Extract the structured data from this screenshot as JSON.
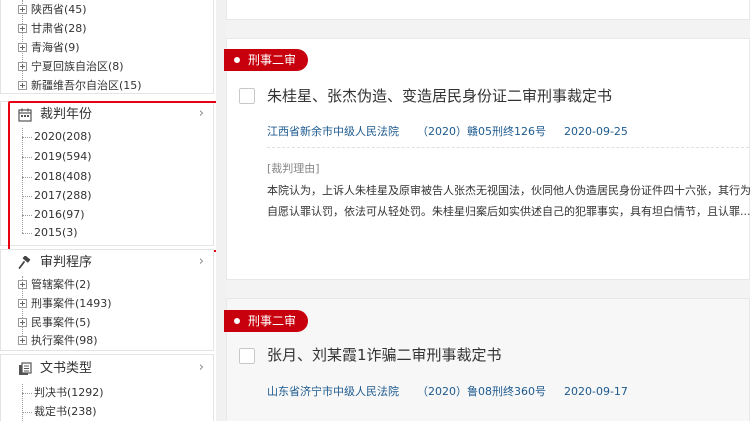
{
  "sidebar": {
    "region_items": [
      {
        "label": "陕西省(45)"
      },
      {
        "label": "甘肃省(28)"
      },
      {
        "label": "青海省(9)"
      },
      {
        "label": "宁夏回族自治区(8)"
      },
      {
        "label": "新疆维吾尔自治区(15)"
      }
    ],
    "year_section": {
      "title": "裁判年份",
      "chevron": "›",
      "items": [
        {
          "label": "2020(208)"
        },
        {
          "label": "2019(594)"
        },
        {
          "label": "2018(408)"
        },
        {
          "label": "2017(288)"
        },
        {
          "label": "2016(97)"
        },
        {
          "label": "2015(3)"
        }
      ]
    },
    "procedure_section": {
      "title": "审判程序",
      "chevron": "›",
      "items": [
        {
          "label": "管辖案件(2)"
        },
        {
          "label": "刑事案件(1493)"
        },
        {
          "label": "民事案件(5)"
        },
        {
          "label": "执行案件(98)"
        }
      ]
    },
    "doctype_section": {
      "title": "文书类型",
      "chevron": "›",
      "items": [
        {
          "label": "判决书(1292)"
        },
        {
          "label": "裁定书(238)"
        }
      ]
    }
  },
  "results": [
    {
      "tag": "刑事二审",
      "title": "朱桂星、张杰伪造、变造居民身份证二审刑事裁定书",
      "court": "江西省新余市中级人民法院",
      "case_no": "（2020）赣05刑终126号",
      "date": "2020-09-25",
      "reason_label": "[裁判理由]",
      "summary_line1": "本院认为，上诉人朱桂星及原审被告人张杰无视国法，伙同他人伪造居民身份证件四十六张，其行为",
      "summary_line2": "自愿认罪认罚，依法可从轻处罚。朱桂星归案后如实供述自己的犯罪事实，具有坦白情节，且认罪..."
    },
    {
      "tag": "刑事二审",
      "title": "张月、刘某霞1诈骗二审刑事裁定书",
      "court": "山东省济宁市中级人民法院",
      "case_no": "（2020）鲁08刑终360号",
      "date": "2020-09-17"
    }
  ],
  "colors": {
    "accent_red": "#c8000d",
    "highlight_red": "#e60012",
    "link_blue": "#1d5a8f"
  },
  "icons": {
    "year": "calendar-icon",
    "procedure": "gavel-icon",
    "doctype": "document-icon"
  }
}
